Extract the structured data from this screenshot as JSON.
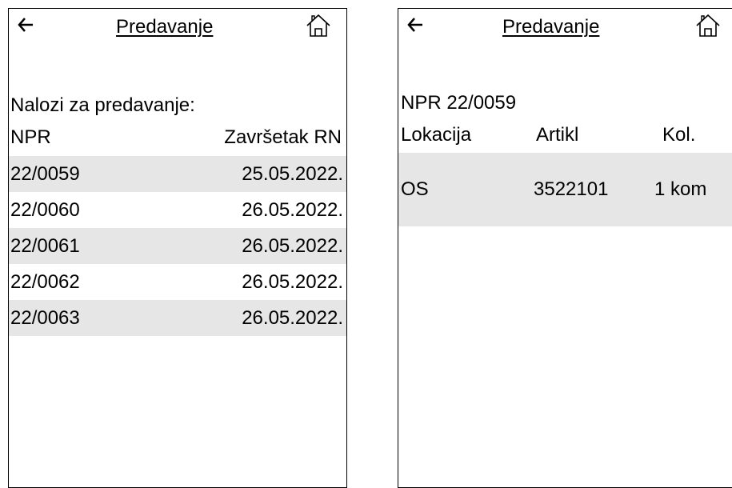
{
  "screens": [
    {
      "title": "Predavanje",
      "subtitle": "Nalozi za predavanje:",
      "columns": [
        "NPR",
        "Završetak RN"
      ],
      "rows": [
        {
          "npr": "22/0059",
          "date": "25.05.2022."
        },
        {
          "npr": "22/0060",
          "date": "26.05.2022."
        },
        {
          "npr": "22/0061",
          "date": "26.05.2022."
        },
        {
          "npr": "22/0062",
          "date": "26.05.2022."
        },
        {
          "npr": "22/0063",
          "date": "26.05.2022."
        }
      ]
    },
    {
      "title": "Predavanje",
      "subtitle": "NPR 22/0059",
      "columns": [
        "Lokacija",
        "Artikl",
        "Kol."
      ],
      "rows": [
        {
          "location": "OS",
          "article": "3522101",
          "quantity": "1 kom"
        }
      ]
    }
  ],
  "icons": {
    "back": "back-arrow-icon",
    "home": "home-icon"
  },
  "colors": {
    "row_shade": "#e6e6e6",
    "border": "#000000"
  }
}
